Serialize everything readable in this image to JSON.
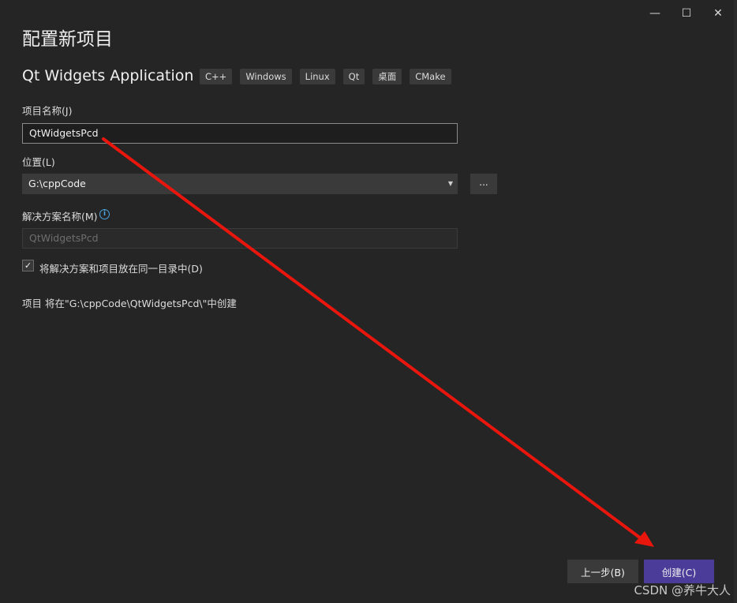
{
  "window": {
    "minimize_glyph": "—",
    "maximize_glyph": "☐",
    "close_glyph": "✕"
  },
  "page_title": "配置新项目",
  "app_name": "Qt Widgets Application",
  "tags": [
    "C++",
    "Windows",
    "Linux",
    "Qt",
    "桌面",
    "CMake"
  ],
  "project_name": {
    "label": "项目名称(J)",
    "value": "QtWidgetsPcd"
  },
  "location": {
    "label": "位置(L)",
    "value": "G:\\cppCode",
    "browse_label": "..."
  },
  "solution_name": {
    "label": "解决方案名称(M)",
    "placeholder": "QtWidgetsPcd"
  },
  "same_dir": {
    "label": "将解决方案和项目放在同一目录中(D)",
    "checked": true,
    "check_glyph": "✓"
  },
  "summary_text": "项目 将在\"G:\\cppCode\\QtWidgetsPcd\\\"中创建",
  "buttons": {
    "back": "上一步(B)",
    "create": "创建(C)"
  },
  "watermark": "CSDN @养牛大人",
  "annotation_color": "#e8160c",
  "accent_color": "#4a3c98"
}
